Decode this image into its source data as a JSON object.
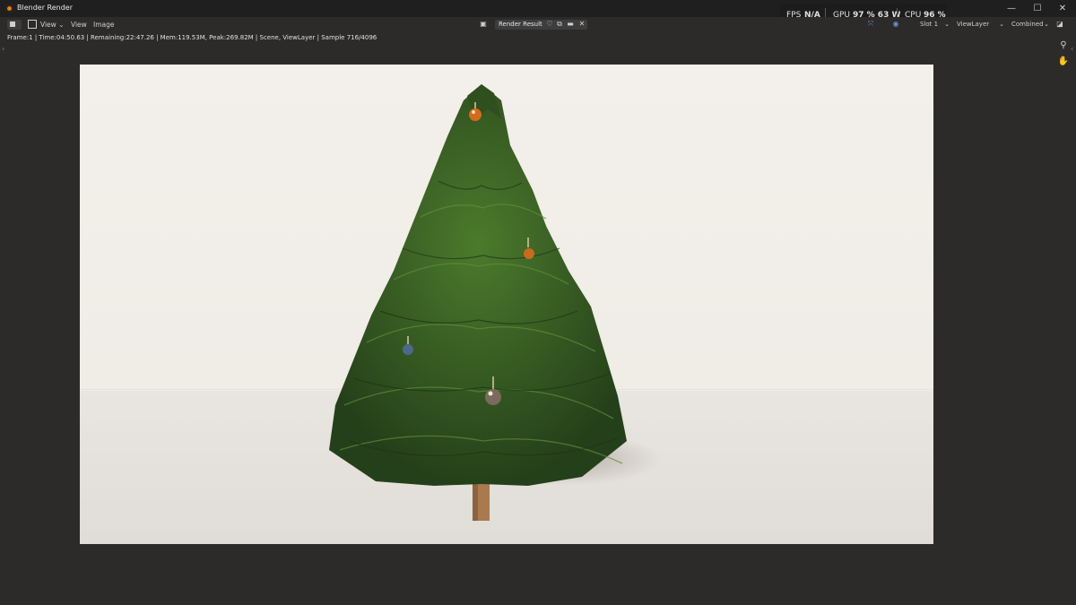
{
  "window": {
    "title": "Blender Render",
    "minimize": "—",
    "maximize": "☐",
    "close": "✕"
  },
  "header": {
    "menu_view1": "View",
    "menu_view2": "View",
    "menu_image": "Image",
    "render_result": "Render Result",
    "slot": "Slot 1",
    "view_layer": "ViewLayer",
    "pass": "Combined"
  },
  "status": {
    "text": "Frame:1 | Time:04:50.63 | Remaining:22:47.26 | Mem:119.53M, Peak:269.82M | Scene, ViewLayer | Sample 716/4096"
  },
  "perf_overlay": {
    "fps_label": "FPS",
    "fps_value": "N/A",
    "gpu_label": "GPU",
    "gpu_value": "97 % 63 W",
    "cpu_label": "CPU",
    "cpu_value": "96 %"
  },
  "colors": {
    "accent_orange": "#e87d0d",
    "tree_green": "#3a5e23",
    "background": "#2c2b29"
  },
  "icons": {
    "zoom": "zoom-icon",
    "pan": "hand-icon"
  }
}
